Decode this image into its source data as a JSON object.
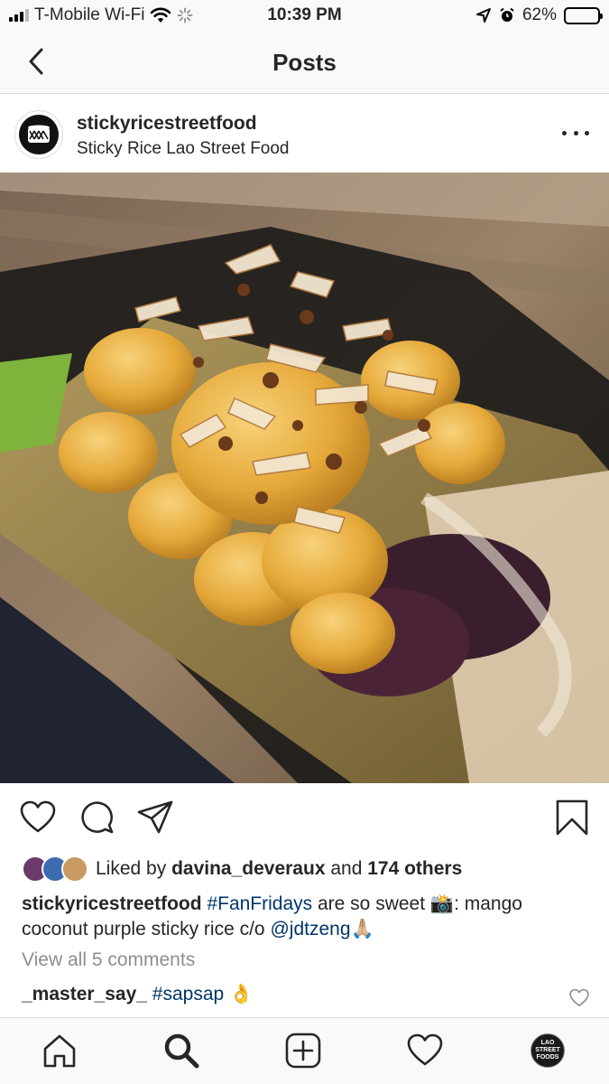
{
  "status_bar": {
    "carrier": "T-Mobile Wi-Fi",
    "time": "10:39 PM",
    "battery": "62%",
    "battery_level": 0.62
  },
  "header": {
    "title": "Posts"
  },
  "post": {
    "username": "stickyricestreetfood",
    "subtitle": "Sticky Rice Lao Street Food",
    "likes": {
      "prefix": "Liked by",
      "user": "davina_deveraux",
      "joiner": "and",
      "others": "174 others"
    },
    "caption": {
      "username": "stickyricestreetfood",
      "hashtag": "#FanFridays",
      "text_1": "are so sweet",
      "emoji_1": "📸",
      "text_2": ": mango coconut purple sticky rice c/o",
      "mention": "@jdtzeng",
      "emoji_2": "🙏🏼"
    },
    "view_comments": "View all 5 comments",
    "comment": {
      "username": "_master_say_",
      "hashtag": "#sapsap",
      "emoji": "👌"
    }
  },
  "profile_tab_text": "LAO STREET FOODS",
  "icons": {
    "back": "chevron-left-icon",
    "more": "more-horizontal-icon",
    "like": "heart-icon",
    "comment": "comment-bubble-icon",
    "share": "paper-plane-icon",
    "save": "bookmark-icon",
    "home": "home-icon",
    "search": "search-icon",
    "new_post": "plus-square-icon",
    "activity": "heart-icon"
  }
}
